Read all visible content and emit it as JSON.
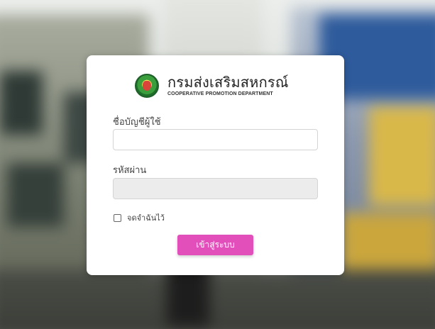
{
  "brand": {
    "title": "กรมส่งเสริมสหกรณ์",
    "subtitle": "COOPERATIVE PROMOTION DEPARTMENT",
    "logo_icon": "cooperative-department-seal-icon"
  },
  "login_form": {
    "username_label": "ชื่อบัญชีผู้ใช้",
    "username_value": "",
    "password_label": "รหัสผ่าน",
    "password_value": "",
    "remember_label": "จดจำฉันไว้",
    "remember_checked": false,
    "submit_label": "เข้าสู่ระบบ"
  },
  "colors": {
    "submit_button": "#e24fbb",
    "card_background": "#ffffff",
    "password_field_background": "#ececec"
  }
}
